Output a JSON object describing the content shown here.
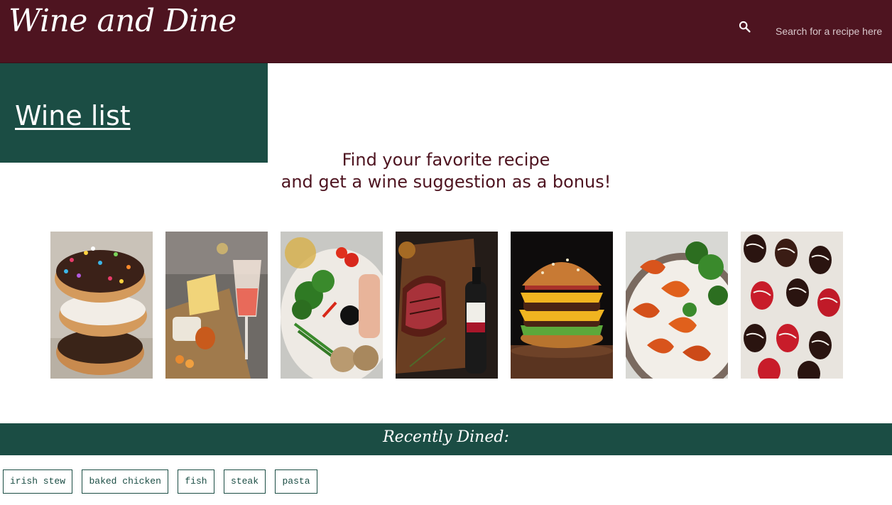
{
  "header": {
    "logo": "Wine and Dine",
    "search": {
      "icon": "search-icon",
      "placeholder": "Search for a recipe here"
    }
  },
  "wine_panel": {
    "link_label": "Wine list"
  },
  "tagline": {
    "line1": "Find your favorite recipe",
    "line2": "and get a wine suggestion as a bonus!"
  },
  "gallery": [
    {
      "name": "recipe-image-donuts"
    },
    {
      "name": "recipe-image-cheese-board"
    },
    {
      "name": "recipe-image-vegetable-platter"
    },
    {
      "name": "recipe-image-steak"
    },
    {
      "name": "recipe-image-burger"
    },
    {
      "name": "recipe-image-shrimp"
    },
    {
      "name": "recipe-image-chocolate-strawberries"
    }
  ],
  "recent": {
    "title": "Recently Dined:",
    "items": [
      "irish stew",
      "baked chicken",
      "fish",
      "steak",
      "pasta"
    ]
  },
  "colors": {
    "brand_burgundy": "#4e1420",
    "brand_green": "#1b4d44",
    "background": "#ffffff"
  }
}
